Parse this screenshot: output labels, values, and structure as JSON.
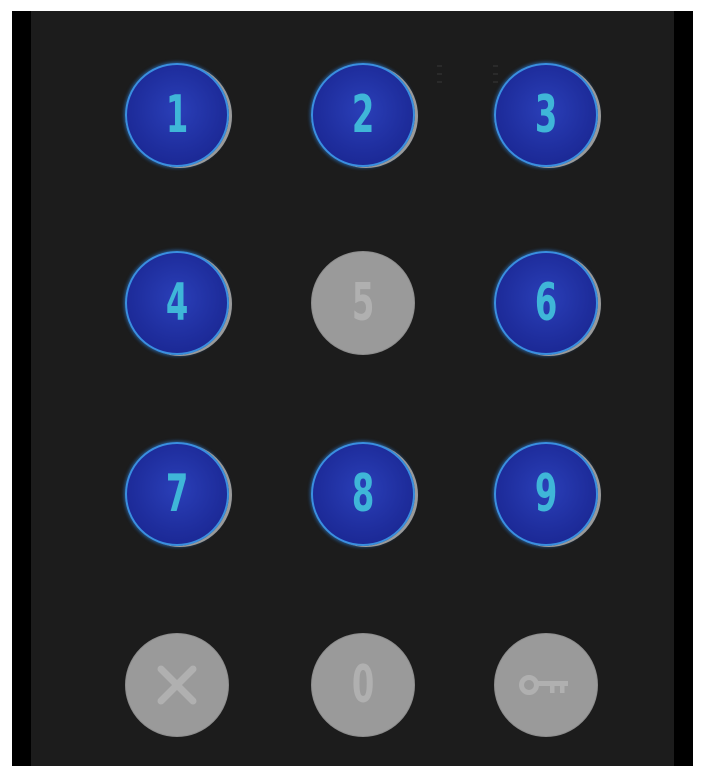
{
  "keypad": {
    "keys": [
      {
        "label": "1",
        "state": "active"
      },
      {
        "label": "2",
        "state": "active"
      },
      {
        "label": "3",
        "state": "active"
      },
      {
        "label": "4",
        "state": "active"
      },
      {
        "label": "5",
        "state": "disabled"
      },
      {
        "label": "6",
        "state": "active"
      },
      {
        "label": "7",
        "state": "active"
      },
      {
        "label": "8",
        "state": "active"
      },
      {
        "label": "9",
        "state": "active"
      },
      {
        "icon": "cancel-icon",
        "state": "disabled"
      },
      {
        "label": "0",
        "state": "disabled"
      },
      {
        "icon": "key-icon",
        "state": "disabled"
      }
    ]
  },
  "colors": {
    "active_fill": "#1f2e9e",
    "active_ring": "#3a8fe0",
    "active_digit": "#3fb6d8",
    "disabled_fill": "#9a9a9a",
    "disabled_digit": "#b0b0b0",
    "panel_background": "#1c1c1c"
  }
}
